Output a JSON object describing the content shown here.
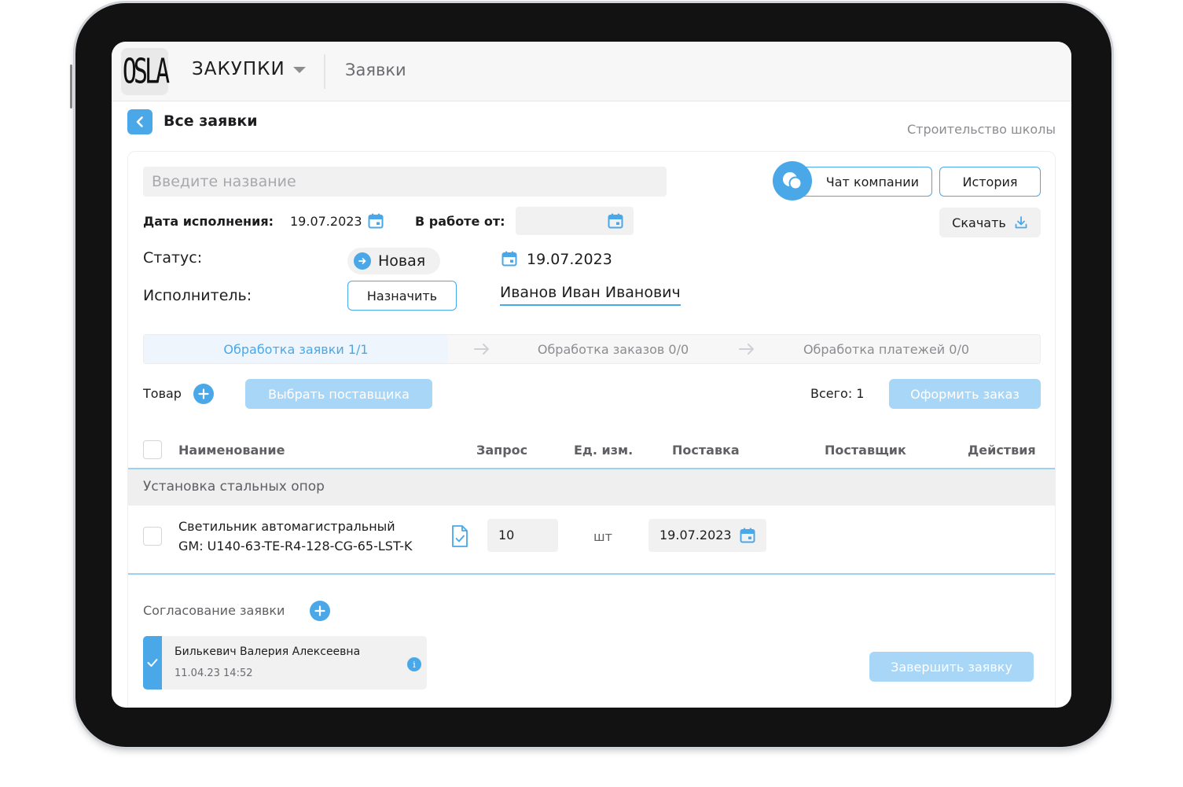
{
  "header": {
    "logo_text": "OSLA",
    "module": "ЗАКУПКИ",
    "section": "Заявки"
  },
  "page": {
    "back_title": "Все заявки",
    "project": "Строительство школы"
  },
  "form": {
    "name_placeholder": "Введите название",
    "chat_label": "Чат компании",
    "history_label": "История",
    "download_label": "Скачать",
    "due_date_label": "Дата исполнения:",
    "due_date_value": "19.07.2023",
    "in_work_label": "В работе от:",
    "in_work_value": "",
    "status_label": "Статус:",
    "status_value": "Новая",
    "status_date": "19.07.2023",
    "executor_label": "Исполнитель:",
    "assign_label": "Назначить",
    "executor_name": "Иванов Иван Иванович"
  },
  "steps": [
    {
      "label": "Обработка заявки 1/1",
      "active": true
    },
    {
      "label": "Обработка заказов 0/0",
      "active": false
    },
    {
      "label": "Обработка платежей 0/0",
      "active": false
    }
  ],
  "products": {
    "label": "Товар",
    "choose_supplier_label": "Выбрать поставщика",
    "total_label": "Всего: 1",
    "order_label": "Оформить заказ"
  },
  "table": {
    "columns": [
      "Наименование",
      "Запрос",
      "Ед. изм.",
      "Поставка",
      "Поставщик",
      "Действия"
    ],
    "group": "Установка стальных опор",
    "rows": [
      {
        "name_line1": "Светильник автомагистральный",
        "name_line2": "GM: U140-63-TE-R4-128-CG-65-LST-K",
        "qty": "10",
        "unit": "шт",
        "delivery": "19.07.2023"
      }
    ]
  },
  "approval": {
    "label": "Согласование заявки",
    "approver_name": "Билькевич Валерия Алексеевна",
    "approver_time": "11.04.23 14:52",
    "info_glyph": "i",
    "finish_label": "Завершить заявку"
  },
  "colors": {
    "accent": "#4aa8e8",
    "accent_light": "#a8d6f6",
    "field_bg": "#f1f1f2"
  }
}
